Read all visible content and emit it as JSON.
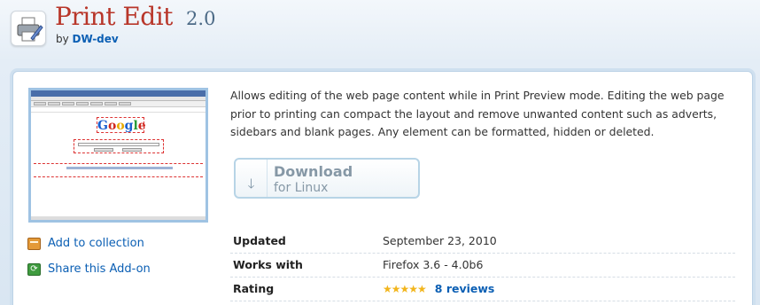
{
  "header": {
    "name": "Print Edit",
    "version": "2.0",
    "by_prefix": "by",
    "author": "DW-dev"
  },
  "thumbnail": {
    "logo_text": "Google"
  },
  "sidebar": {
    "add_to_collection": "Add to collection",
    "share": "Share this Add-on"
  },
  "description": "Allows editing of the web page content while in Print Preview mode. Editing the web page prior to printing can compact the layout and remove unwanted content such as adverts, sidebars and blank pages. Any element can be formatted, hidden or deleted.",
  "download": {
    "label": "Download",
    "platform": "for Linux",
    "icon": "down-arrow-icon"
  },
  "details": {
    "updated_label": "Updated",
    "updated_value": "September 23, 2010",
    "works_label": "Works with",
    "works_value": "Firefox 3.6 - 4.0b6",
    "rating_label": "Rating",
    "rating_stars": "★★★★★",
    "rating_value": 5,
    "reviews": "8 reviews"
  },
  "colors": {
    "title": "#b8362a",
    "link": "#0b5fb4",
    "panel_border": "#bcd2e6",
    "star": "#f2b51c"
  }
}
